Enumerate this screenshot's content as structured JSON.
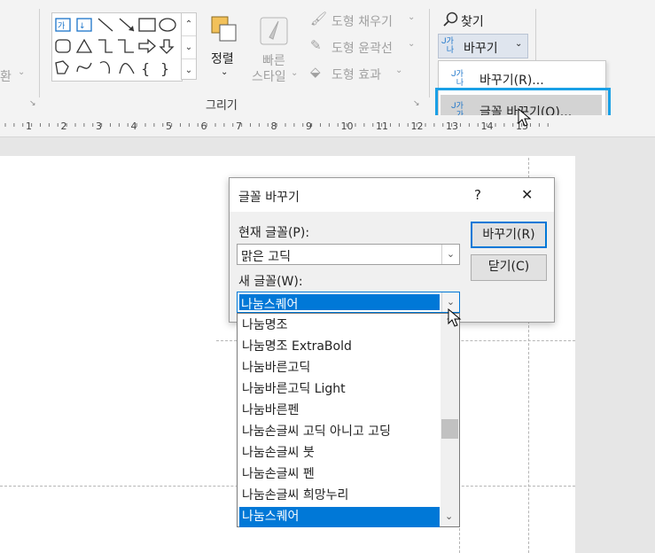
{
  "ribbon": {
    "left_partial_label": "환",
    "shapes_group_label": "그리기",
    "arrange_label": "정렬",
    "quick_styles_line1": "빠른",
    "quick_styles_line2": "스타일",
    "shape_fill": "도형 채우기",
    "shape_outline": "도형 윤곽선",
    "shape_effects": "도형 효과",
    "find": "찾기",
    "replace": "바꾸기",
    "shape_scroll_up": "⌃",
    "shape_scroll_down": "⌄",
    "shape_more": "⌄"
  },
  "replace_menu": {
    "items": [
      {
        "label": "바꾸기(R)..."
      },
      {
        "label": "글꼴 바꾸기(O)..."
      }
    ]
  },
  "ruler": {
    "labels": [
      "1",
      "2",
      "3",
      "4",
      "5",
      "6",
      "7",
      "8",
      "9",
      "10",
      "11",
      "12",
      "13",
      "14",
      "15"
    ]
  },
  "dialog": {
    "title": "글꼴 바꾸기",
    "help": "?",
    "close": "✕",
    "current_font_label": "현재 글꼴(P):",
    "current_font_value": "맑은 고딕",
    "new_font_label": "새 글꼴(W):",
    "new_font_value": "나눔스퀘어",
    "replace_button": "바꾸기(R)",
    "close_button": "닫기(C)"
  },
  "font_list": {
    "items": [
      "나눔명조",
      "나눔명조 ExtraBold",
      "나눔바른고딕",
      "나눔바른고딕 Light",
      "나눔바른펜",
      "나눔손글씨 고딕 아니고 고딩",
      "나눔손글씨 붓",
      "나눔손글씨 펜",
      "나눔손글씨 희망누리",
      "나눔스퀘어"
    ],
    "selected": "나눔스퀘어",
    "scroll_up": "⌃",
    "scroll_down": "⌄"
  },
  "colors": {
    "accent": "#0a78d7",
    "selection": "#0078d7",
    "highlight_border": "#1aa0e6"
  }
}
